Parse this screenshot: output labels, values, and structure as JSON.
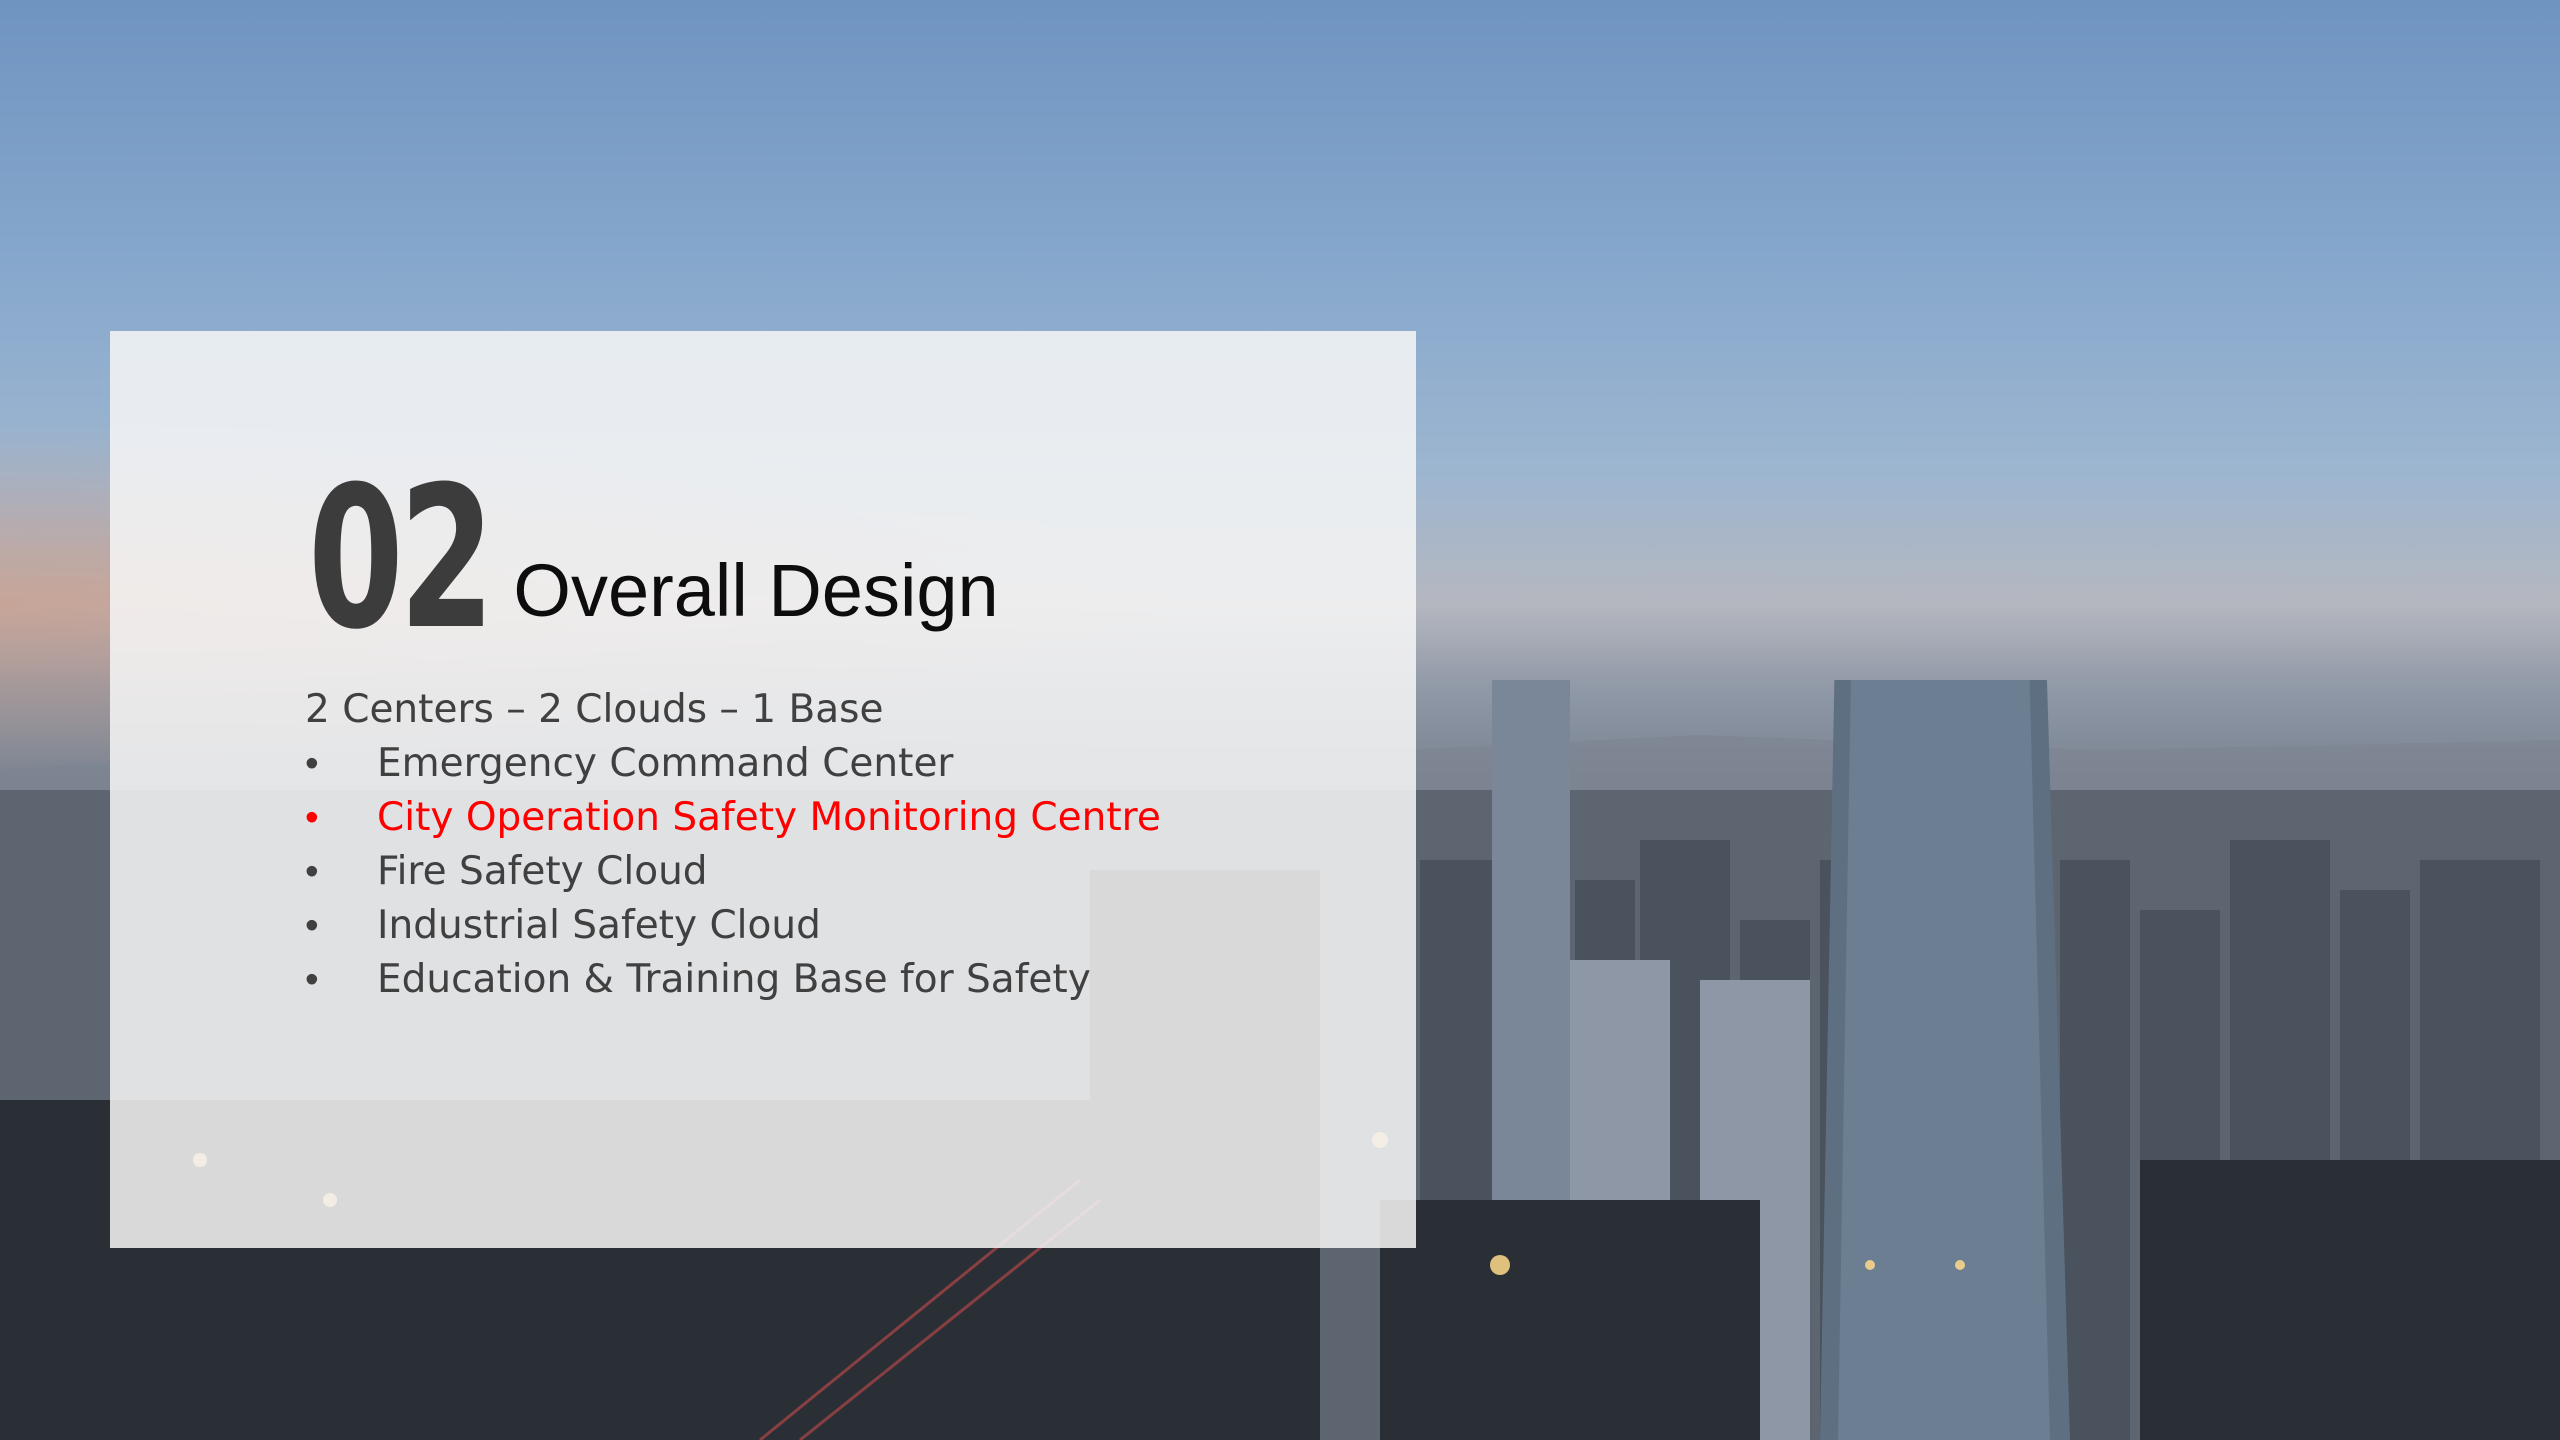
{
  "slide": {
    "section_number": "02",
    "section_title": "Overall Design",
    "subtitle": "2 Centers – 2 Clouds – 1 Base",
    "bullet_char": "•",
    "highlight_color": "#ff0000",
    "items": [
      {
        "label": "Emergency Command Center",
        "highlighted": false
      },
      {
        "label": "City Operation Safety Monitoring Centre",
        "highlighted": true
      },
      {
        "label": "Fire Safety Cloud",
        "highlighted": false
      },
      {
        "label": "Industrial Safety Cloud",
        "highlighted": false
      },
      {
        "label": "Education & Training Base for Safety",
        "highlighted": false
      }
    ]
  },
  "background": {
    "description_icon": "city-skyline-photo"
  }
}
